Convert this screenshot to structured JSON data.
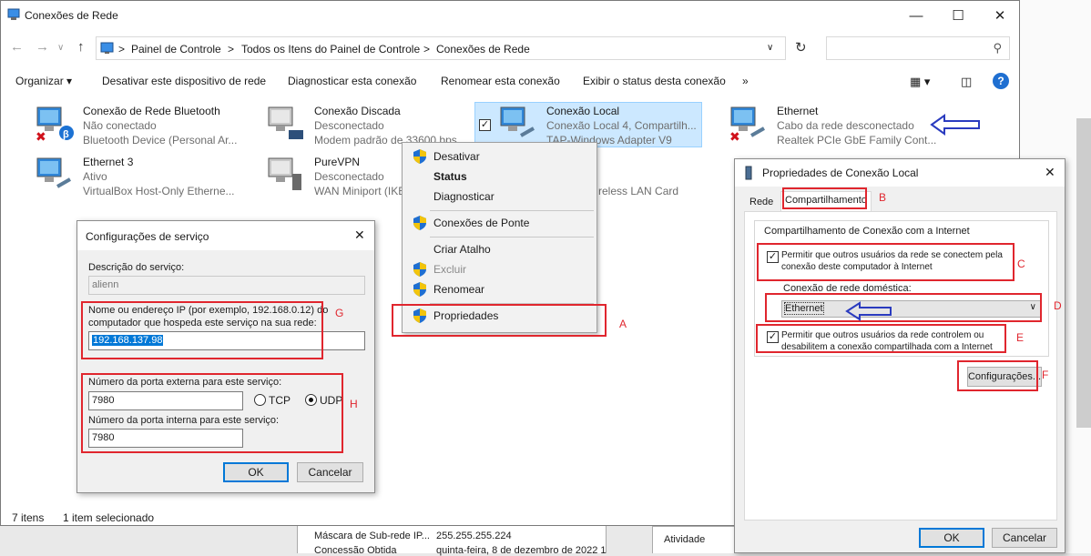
{
  "window": {
    "title": "Conexões de Rede"
  },
  "address": {
    "crumbs": [
      "Painel de Controle",
      "Todos os Itens do Painel de Controle",
      "Conexões de Rede"
    ],
    "separator": ">"
  },
  "toolbar": {
    "organize": "Organizar ▾",
    "disable": "Desativar este dispositivo de rede",
    "diagnose": "Diagnosticar esta conexão",
    "rename": "Renomear esta conexão",
    "status": "Exibir o status desta conexão",
    "more": "»"
  },
  "connections": [
    {
      "name": "Conexão de Rede Bluetooth",
      "state": "Não conectado",
      "device": "Bluetooth Device (Personal Ar..."
    },
    {
      "name": "Conexão Discada",
      "state": "Desconectado",
      "device": "Modem padrão de 33600 bps"
    },
    {
      "name": "Conexão Local",
      "state": "Conexão Local 4, Compartilh...",
      "device": "TAP-Windows Adapter V9"
    },
    {
      "name": "Ethernet",
      "state": "Cabo da rede desconectado",
      "device": "Realtek PCIe GbE Family Cont..."
    },
    {
      "name": "Ethernet 3",
      "state": "Ativo",
      "device": "VirtualBox Host-Only Etherne..."
    },
    {
      "name": "PureVPN",
      "state": "Desconectado",
      "device": "WAN Miniport (IKE"
    },
    {
      "name": "",
      "state": "",
      "device": "reless LAN Card"
    }
  ],
  "statusbar": {
    "count": "7 itens",
    "selected": "1 item selecionado"
  },
  "context_menu": {
    "items": [
      "Desativar",
      "Status",
      "Diagnosticar",
      "Conexões de Ponte",
      "Criar Atalho",
      "Excluir",
      "Renomear",
      "Propriedades"
    ]
  },
  "service_dialog": {
    "title": "Configurações de serviço",
    "desc_label": "Descrição do serviço:",
    "desc_value": "alienn",
    "ip_label_1": "Nome ou endereço IP (por exemplo, 192.168.0.12) do",
    "ip_label_2": "computador que hospeda este serviço na sua rede:",
    "ip_value": "192.168.137.98",
    "ext_port_label": "Número da porta externa para este serviço:",
    "ext_port_value": "7980",
    "tcp": "TCP",
    "udp": "UDP",
    "int_port_label": "Número da porta interna para este serviço:",
    "int_port_value": "7980",
    "ok": "OK",
    "cancel": "Cancelar"
  },
  "props_dialog": {
    "title": "Propriedades de Conexão Local",
    "tab_network": "Rede",
    "tab_sharing": "Compartilhamento",
    "group_title": "Compartilhamento de Conexão com a Internet",
    "allow_connect_1": "Permitir que outros usuários da rede se conectem pela",
    "allow_connect_2": "conexão deste computador à Internet",
    "home_label": "Conexão de rede doméstica:",
    "home_value": "Ethernet",
    "allow_control_1": "Permitir que outros usuários da rede controlem ou",
    "allow_control_2": "desabilitem a conexão compartilhada com a Internet",
    "settings": "Configurações...",
    "ok": "OK",
    "cancel": "Cancelar"
  },
  "background": {
    "mask_label": "Máscara de Sub-rede IP...",
    "mask_value": "255.255.255.224",
    "lease_label": "Concessão Obtida",
    "lease_value": "quinta-feira, 8 de dezembro de 2022 1",
    "activity": "Atividade"
  },
  "annotations": {
    "A": "A",
    "B": "B",
    "C": "C",
    "D": "D",
    "E": "E",
    "F": "F",
    "G": "G",
    "H": "H"
  },
  "colors": {
    "annotation": "#e0262e",
    "arrow": "#2a3bbf",
    "selection": "#cce8ff"
  }
}
